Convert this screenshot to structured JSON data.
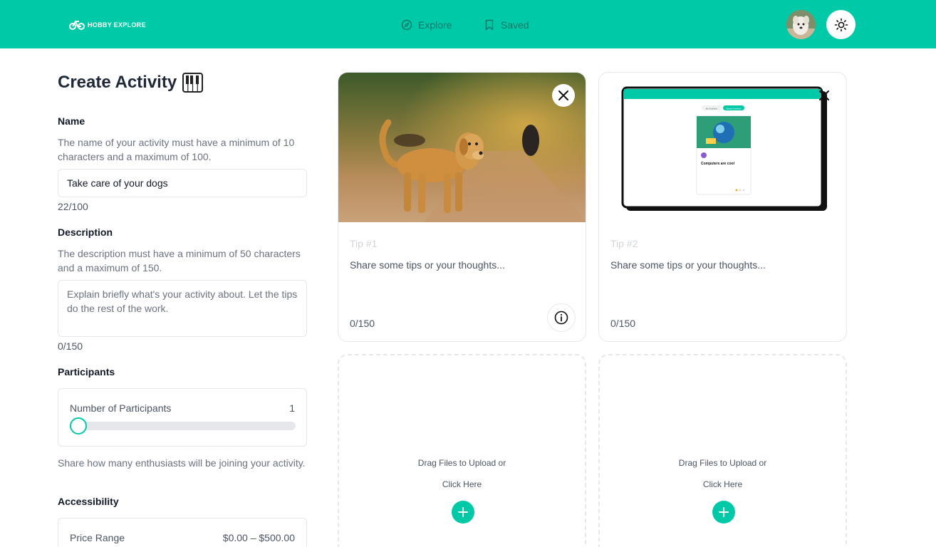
{
  "header": {
    "logo_text": "HOBBY EXPLORE",
    "nav": [
      {
        "label": "Explore",
        "icon": "compass-icon"
      },
      {
        "label": "Saved",
        "icon": "bookmark-icon"
      }
    ],
    "theme_icon": "sun-icon",
    "accent_color": "#00c9a7"
  },
  "form": {
    "title": "Create Activity",
    "title_icon": "piano-icon",
    "name": {
      "label": "Name",
      "help": "The name of your activity must have a minimum of 10 characters and a maximum of 100.",
      "value": "Take care of your dogs",
      "counter": "22/100"
    },
    "description": {
      "label": "Description",
      "help": "The description must have a minimum of 50 characters and a maximum of 150.",
      "placeholder": "Explain briefly what's your activity about. Let the tips do the rest of the work.",
      "counter": "0/150"
    },
    "participants": {
      "label": "Participants",
      "box_label": "Number of Participants",
      "value": "1",
      "help": "Share how many enthusiasts will be joining your activity."
    },
    "accessibility": {
      "label": "Accessibility",
      "box_label": "Price Range",
      "value": "$0.00 – $500.00"
    }
  },
  "tips": [
    {
      "label": "Tip #1",
      "placeholder": "Share some tips or your thoughts...",
      "counter": "0/150",
      "image": "golden-retriever-photo"
    },
    {
      "label": "Tip #2",
      "placeholder": "Share some tips or your thoughts...",
      "counter": "0/150",
      "image": "app-screenshot",
      "mini_screenshot": {
        "tab1": "My Activities",
        "tab2": "Saved Activities",
        "post_title": "Computers are cool"
      }
    }
  ],
  "upload": {
    "line1": "Drag Files to Upload or",
    "line2": "Click Here"
  }
}
